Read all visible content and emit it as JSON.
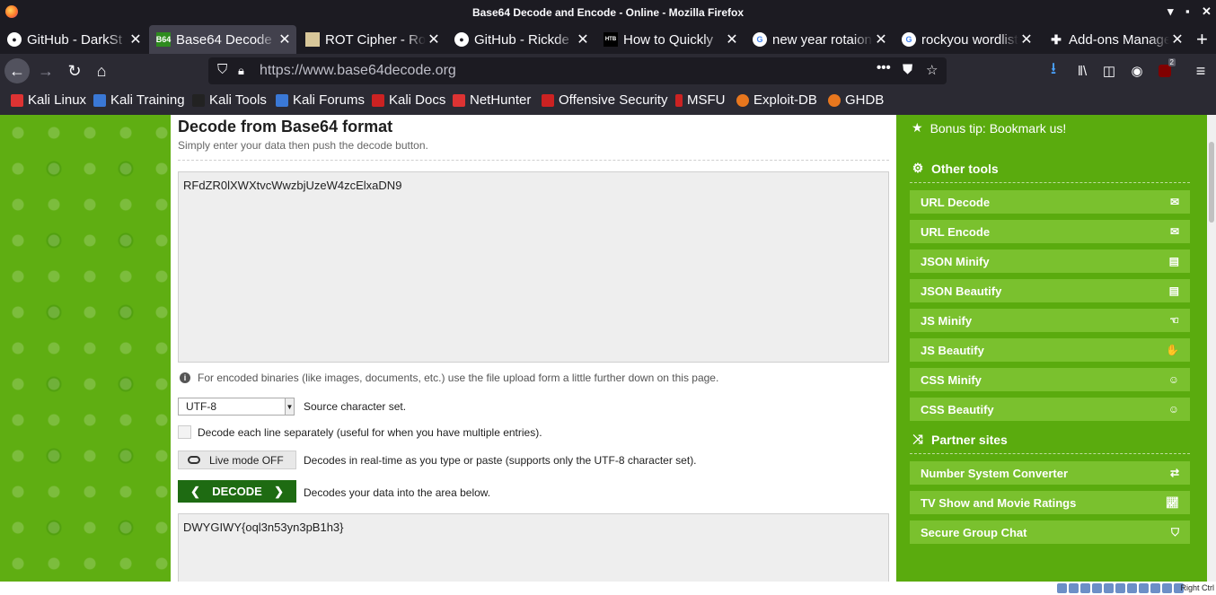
{
  "window": {
    "title": "Base64 Decode and Encode - Online - Mozilla Firefox"
  },
  "tabs": [
    {
      "label": "GitHub - DarkSt",
      "icon": "github-icon"
    },
    {
      "label": "Base64 Decode",
      "icon": "b64-icon",
      "active": true
    },
    {
      "label": "ROT Cipher - Ro",
      "icon": "page-icon"
    },
    {
      "label": "GitHub - Rickde",
      "icon": "github-icon"
    },
    {
      "label": "How to Quickly",
      "icon": "htb-icon"
    },
    {
      "label": "new year rotaion",
      "icon": "google-icon"
    },
    {
      "label": "rockyou wordlist",
      "icon": "google-icon"
    },
    {
      "label": "Add-ons Manage",
      "icon": "puzzle-icon"
    }
  ],
  "nav": {
    "url": "https://www.base64decode.org",
    "addon_badge": "2"
  },
  "bookmarks": [
    "Kali Linux",
    "Kali Training",
    "Kali Tools",
    "Kali Forums",
    "Kali Docs",
    "NetHunter",
    "Offensive Security",
    "MSFU",
    "Exploit-DB",
    "GHDB"
  ],
  "main": {
    "heading": "Decode from Base64 format",
    "subheading": "Simply enter your data then push the decode button.",
    "input_value": "RFdZR0lXWXtvcWwzbjUzeW4zcElxaDN9",
    "info_text": "For encoded binaries (like images, documents, etc.) use the file upload form a little further down on this page.",
    "charset_value": "UTF-8",
    "charset_label": "Source character set.",
    "separate_label": "Decode each line separately (useful for when you have multiple entries).",
    "live_mode_label": "Live mode OFF",
    "live_mode_desc": "Decodes in real-time as you type or paste (supports only the UTF-8 character set).",
    "decode_label": "DECODE",
    "decode_desc": "Decodes your data into the area below.",
    "output_value": "DWYGIWY{oql3n53yn3pB1h3}"
  },
  "sidebar": {
    "tip": "Bonus tip: Bookmark us!",
    "other_tools_heading": "Other tools",
    "other_tools": [
      {
        "label": "URL Decode",
        "icon": "envelope-open-icon"
      },
      {
        "label": "URL Encode",
        "icon": "envelope-icon"
      },
      {
        "label": "JSON Minify",
        "icon": "file-icon"
      },
      {
        "label": "JSON Beautify",
        "icon": "file-icon"
      },
      {
        "label": "JS Minify",
        "icon": "hand-icon"
      },
      {
        "label": "JS Beautify",
        "icon": "hand-icon"
      },
      {
        "label": "CSS Minify",
        "icon": "smile-icon"
      },
      {
        "label": "CSS Beautify",
        "icon": "smile-icon"
      }
    ],
    "partner_heading": "Partner sites",
    "partners": [
      {
        "label": "Number System Converter",
        "icon": "exchange-icon"
      },
      {
        "label": "TV Show and Movie Ratings",
        "icon": "chart-icon"
      },
      {
        "label": "Secure Group Chat",
        "icon": "shield-icon"
      }
    ]
  },
  "statusbar": {
    "host_key": "Right Ctrl"
  }
}
